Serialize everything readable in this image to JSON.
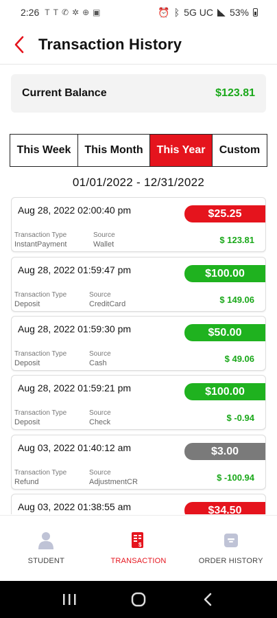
{
  "status_bar": {
    "time": "2:26",
    "network": "5G UC",
    "battery": "53%"
  },
  "header": {
    "title": "Transaction History"
  },
  "balance": {
    "label": "Current Balance",
    "value": "$123.81"
  },
  "period_tabs": [
    {
      "label": "This Week",
      "active": false
    },
    {
      "label": "This Month",
      "active": false
    },
    {
      "label": "This Year",
      "active": true
    },
    {
      "label": "Custom",
      "active": false
    }
  ],
  "date_range": "01/01/2022 - 12/31/2022",
  "transactions": [
    {
      "date": "Aug 28, 2022 02:00:40 pm",
      "amount": "$25.25",
      "amount_color": "#e5141d",
      "type_label": "Transaction Type",
      "type": "InstantPayment",
      "source_label": "Source",
      "source": "Wallet",
      "balance": "$ 123.81"
    },
    {
      "date": "Aug 28, 2022 01:59:47 pm",
      "amount": "$100.00",
      "amount_color": "#1fb21f",
      "type_label": "Transaction Type",
      "type": "Deposit",
      "source_label": "Source",
      "source": "CreditCard",
      "balance": "$ 149.06"
    },
    {
      "date": "Aug 28, 2022 01:59:30 pm",
      "amount": "$50.00",
      "amount_color": "#1fb21f",
      "type_label": "Transaction Type",
      "type": "Deposit",
      "source_label": "Source",
      "source": "Cash",
      "balance": "$ 49.06"
    },
    {
      "date": "Aug 28, 2022 01:59:21 pm",
      "amount": "$100.00",
      "amount_color": "#1fb21f",
      "type_label": "Transaction Type",
      "type": "Deposit",
      "source_label": "Source",
      "source": "Check",
      "balance": "$ -0.94"
    },
    {
      "date": "Aug 03, 2022 01:40:12 am",
      "amount": "$3.00",
      "amount_color": "#7a7a7a",
      "type_label": "Transaction Type",
      "type": "Refund",
      "source_label": "Source",
      "source": "AdjustmentCR",
      "balance": "$ -100.94"
    },
    {
      "date": "Aug 03, 2022 01:38:55 am",
      "amount": "$34.50",
      "amount_color": "#e5141d",
      "type_label": "",
      "type": "",
      "source_label": "",
      "source": "",
      "balance": ""
    }
  ],
  "bottom_nav": [
    {
      "label": "STUDENT",
      "icon": "student-icon",
      "active": false
    },
    {
      "label": "TRANSACTION",
      "icon": "transaction-icon",
      "active": true
    },
    {
      "label": "ORDER HISTORY",
      "icon": "order-history-icon",
      "active": false
    }
  ],
  "colors": {
    "accent_red": "#e5141d",
    "positive_green": "#1aa81a",
    "neutral_gray": "#7a7a7a"
  }
}
